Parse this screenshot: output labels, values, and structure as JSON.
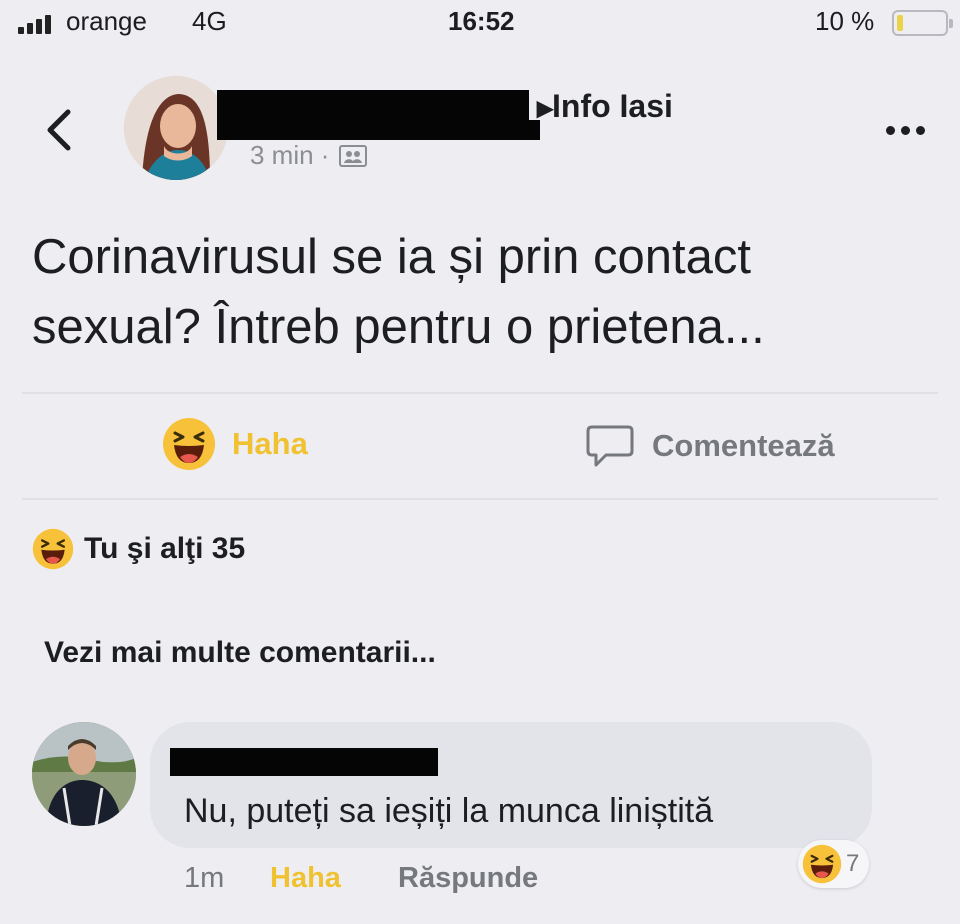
{
  "status_bar": {
    "carrier": "orange",
    "network": "4G",
    "time": "16:52",
    "battery": "10 %",
    "battery_level": 0.1
  },
  "post": {
    "group_name": "Info Iasi",
    "time": "3 min ·",
    "text_line1": "Corinavirusul se ia și prin contact",
    "text_line2": "sexual? Întreb pentru o prietena..."
  },
  "actions": {
    "haha_label": "Haha",
    "comment_label": "Comentează"
  },
  "reactions": {
    "summary": "Tu şi alţi 35"
  },
  "comments": {
    "more_label": "Vezi mai multe comentarii...",
    "items": [
      {
        "text": "Nu, puteți sa ieșiți la munca liniștită",
        "time": "1m",
        "haha_label": "Haha",
        "reply_label": "Răspunde",
        "reaction_count": "7"
      }
    ]
  },
  "colors": {
    "haha_accent": "#f0c232",
    "secondary_text": "#75787c",
    "background": "#eeeef2"
  }
}
